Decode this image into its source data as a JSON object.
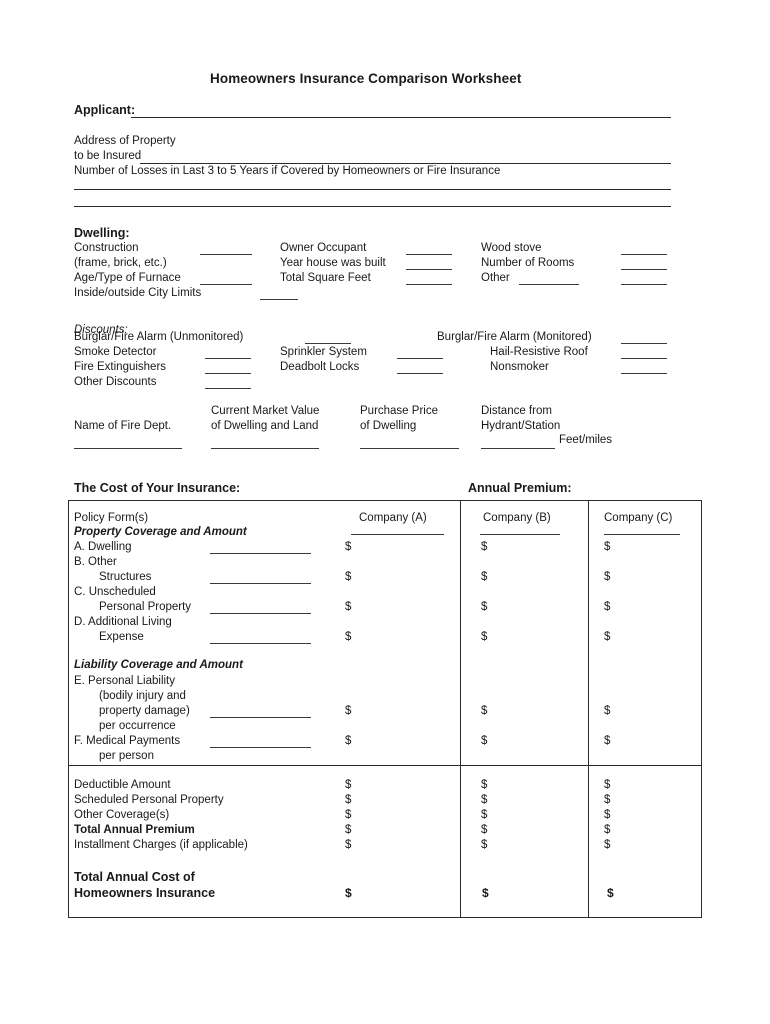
{
  "document": {
    "title": "Homeowners Insurance Comparison Worksheet"
  },
  "applicant": {
    "label": "Applicant:"
  },
  "address": {
    "line1": "Address of Property",
    "line2": "to be Insured",
    "losses_label": "Number of Losses in Last 3 to 5 Years if Covered by Homeowners or Fire Insurance"
  },
  "dwelling": {
    "heading": "Dwelling:",
    "col1": [
      "Construction",
      "(frame, brick, etc.)",
      "Age/Type of Furnace",
      "Inside/outside City Limits"
    ],
    "col2": [
      "Owner Occupant",
      "Year house was built",
      "Total Square Feet"
    ],
    "col3": [
      "Wood stove",
      "Number of Rooms",
      "Other"
    ]
  },
  "discounts": {
    "heading": "Discounts:",
    "col1": [
      "Burglar/Fire Alarm (Unmonitored)",
      "Smoke Detector",
      "Fire Extinguishers",
      "Other Discounts"
    ],
    "col2": [
      "Sprinkler System",
      "Deadbolt Locks"
    ],
    "col3": [
      "Burglar/Fire Alarm (Monitored)",
      "Hail-Resistive Roof",
      "Nonsmoker"
    ]
  },
  "property_info": {
    "fire_dept": "Name of Fire Dept.",
    "market_value_l1": "Current Market Value",
    "market_value_l2": "of Dwelling and Land",
    "purchase_price_l1": "Purchase Price",
    "purchase_price_l2": "of Dwelling",
    "distance_l1": "Distance from",
    "distance_l2": "Hydrant/Station",
    "feet_miles": "Feet/miles"
  },
  "cost_section": {
    "heading": "The Cost of Your Insurance:",
    "annual_premium": "Annual Premium:"
  },
  "table": {
    "row_label": "Policy Form(s)",
    "columns": [
      "Company (A)",
      "Company (B)",
      "Company (C)"
    ],
    "property_heading": "Property Coverage and Amount",
    "property_rows": [
      {
        "line1": "A. Dwelling",
        "line2": "",
        "amount": "$"
      },
      {
        "line1": "B. Other",
        "line2": "Structures",
        "amount": "$"
      },
      {
        "line1": "C. Unscheduled",
        "line2": "Personal Property",
        "amount": "$"
      },
      {
        "line1": "D. Additional Living",
        "line2": "Expense",
        "amount": "$"
      }
    ],
    "liability_heading": "Liability Coverage and Amount",
    "liability_rows": [
      {
        "l1": "E. Personal Liability",
        "l2": "(bodily injury and",
        "l3": "property damage)",
        "l4": "per occurrence",
        "amount": "$"
      },
      {
        "l1": "F. Medical Payments",
        "l2": "per person",
        "amount": "$"
      }
    ],
    "summary_rows": [
      {
        "label": "Deductible Amount",
        "bold": false,
        "amount": "$"
      },
      {
        "label": "Scheduled Personal Property",
        "bold": false,
        "amount": "$"
      },
      {
        "label": "Other Coverage(s)",
        "bold": false,
        "amount": "$"
      },
      {
        "label": "Total Annual Premium",
        "bold": true,
        "amount": "$"
      },
      {
        "label": "Installment Charges (if applicable)",
        "bold": false,
        "amount": "$"
      }
    ],
    "total_row": {
      "line1": "Total Annual Cost of",
      "line2": "Homeowners Insurance",
      "amount": "$"
    }
  },
  "colors": {
    "text": "#1a1a1a",
    "rule": "#2b2b2b",
    "page_bg": "#ffffff"
  }
}
